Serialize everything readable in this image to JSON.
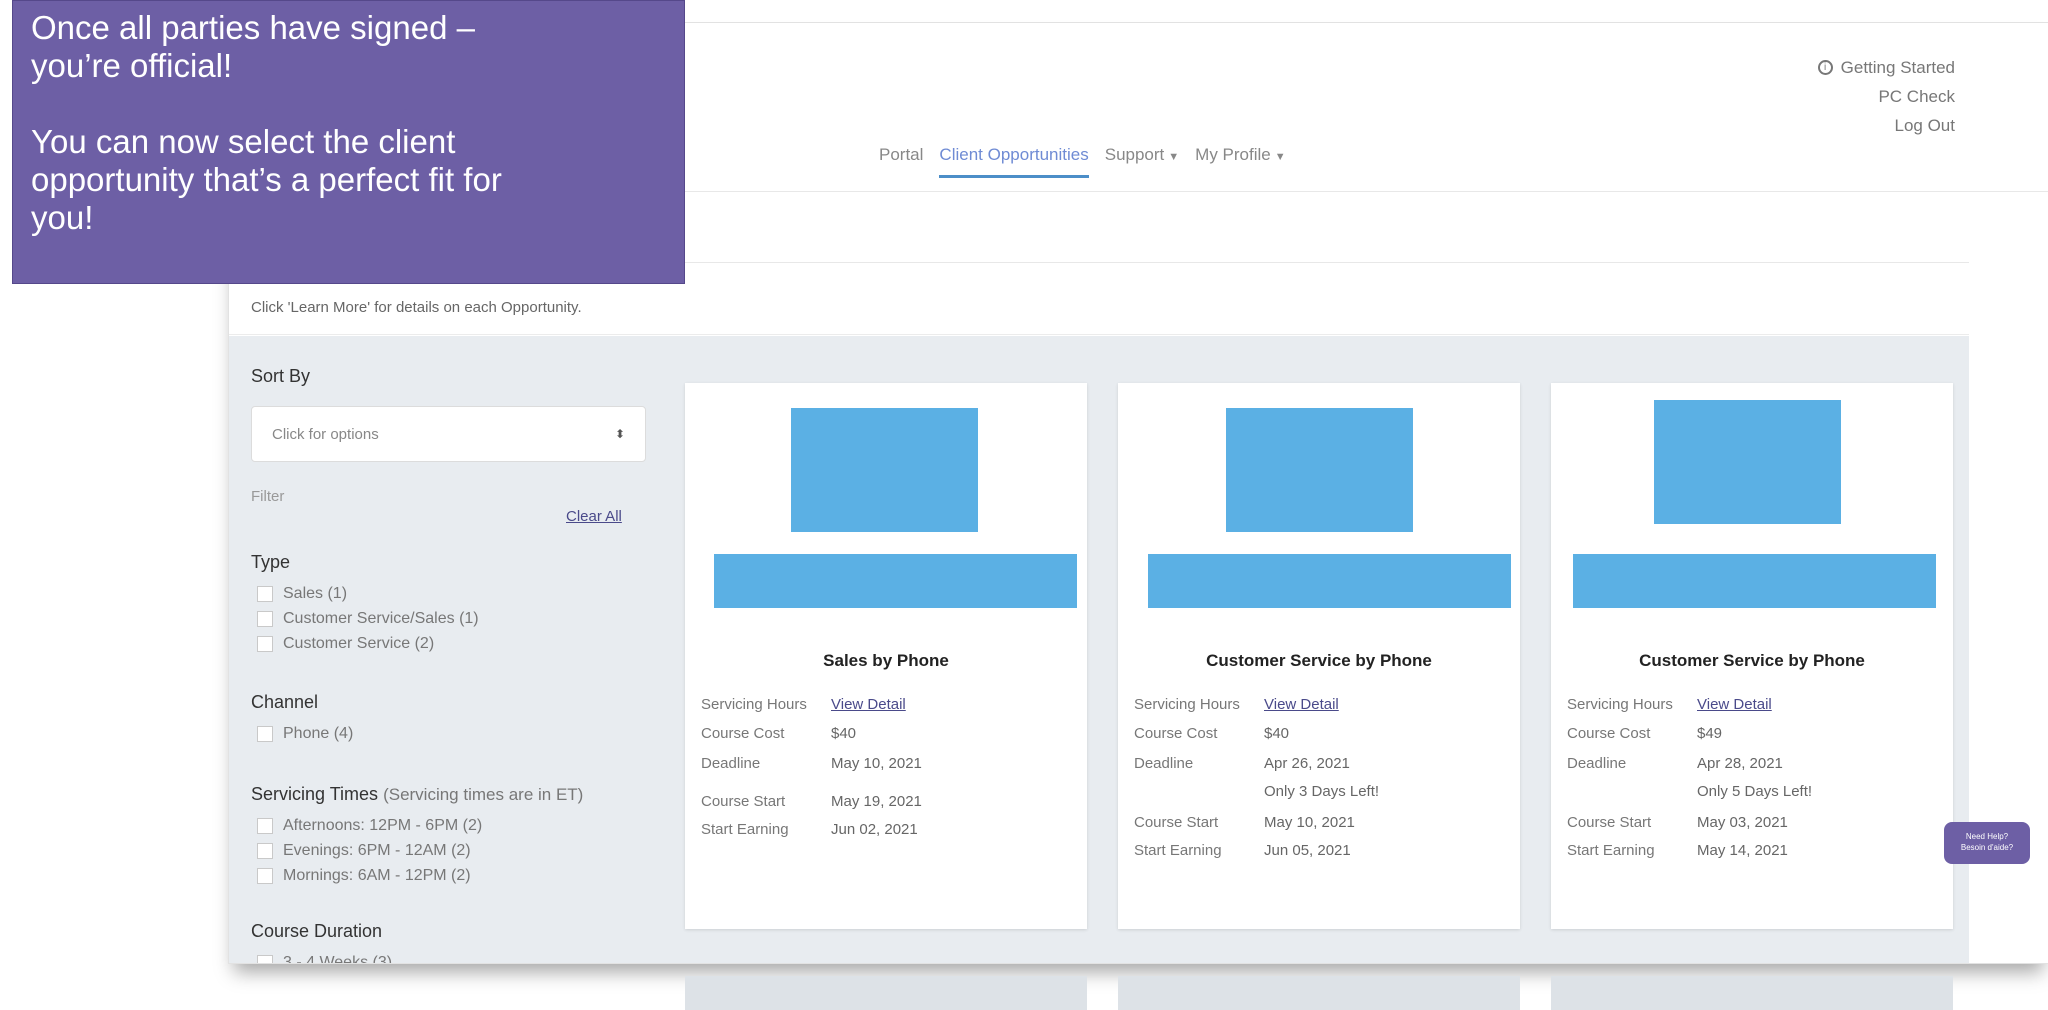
{
  "overlay": {
    "line1": "Once all parties have signed –",
    "line2": "you’re official!",
    "line3": "You can now select the client",
    "line4": "opportunity that’s a perfect fit for",
    "line5": "you!"
  },
  "top_links": {
    "getting_started": "Getting Started",
    "pc_check": "PC Check",
    "log_out": "Log Out"
  },
  "nav": {
    "portal": "Portal",
    "client_opportunities": "Client Opportunities",
    "support": "Support",
    "my_profile": "My Profile"
  },
  "intro_text": "Click 'Learn More' for details on each Opportunity.",
  "sidebar": {
    "sort_by": "Sort By",
    "sort_placeholder": "Click for options",
    "sort_caret": "⬍",
    "filter": "Filter",
    "clear_all": "Clear All",
    "type": {
      "title": "Type",
      "options": [
        "Sales (1)",
        "Customer Service/Sales (1)",
        "Customer Service (2)"
      ]
    },
    "channel": {
      "title": "Channel",
      "options": [
        "Phone (4)"
      ]
    },
    "servicing_times": {
      "title": "Servicing Times",
      "note": "(Servicing times are in ET)",
      "options": [
        "Afternoons: 12PM - 6PM (2)",
        "Evenings: 6PM - 12AM (2)",
        "Mornings: 6AM - 12PM (2)"
      ]
    },
    "course_duration": {
      "title": "Course Duration",
      "options": [
        "3 - 4 Weeks (3)"
      ]
    }
  },
  "labels": {
    "servicing_hours": "Servicing Hours",
    "course_cost": "Course Cost",
    "deadline": "Deadline",
    "course_start": "Course Start",
    "start_earning": "Start Earning",
    "view_detail": "View Detail"
  },
  "cards": [
    {
      "title": "Sales by Phone",
      "course_cost": "$40",
      "deadline": "May 10, 2021",
      "days_left": "",
      "course_start": "May 19, 2021",
      "start_earning": "Jun 02, 2021"
    },
    {
      "title": "Customer Service by Phone",
      "course_cost": "$40",
      "deadline": "Apr 26, 2021",
      "days_left": "Only 3 Days Left!",
      "course_start": "May 10, 2021",
      "start_earning": "Jun 05, 2021"
    },
    {
      "title": "Customer Service by Phone",
      "course_cost": "$49",
      "deadline": "Apr 28, 2021",
      "days_left": "Only 5 Days Left!",
      "course_start": "May 03, 2021",
      "start_earning": "May 14, 2021"
    }
  ],
  "help_bubble": {
    "line1": "Need Help?",
    "line2": "Besoin d'aide?"
  },
  "colors": {
    "overlay_purple": "#6d5fa5",
    "placeholder_blue": "#5bb0e4",
    "nav_active": "#4c8ec8",
    "panel_gray": "#e8ecf0"
  }
}
